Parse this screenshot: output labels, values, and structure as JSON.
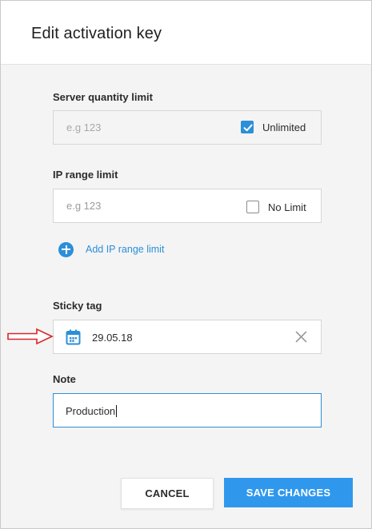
{
  "dialog": {
    "title": "Edit activation key"
  },
  "server_quantity": {
    "label": "Server quantity limit",
    "placeholder": "e.g 123",
    "checkbox_label": "Unlimited",
    "checked": true
  },
  "ip_range": {
    "label": "IP range limit",
    "placeholder": "e.g 123",
    "checkbox_label": "No Limit",
    "checked": false,
    "add_label": "Add IP range limit"
  },
  "sticky_tag": {
    "label": "Sticky tag",
    "value": "29.05.18",
    "icon": "calendar-icon"
  },
  "note": {
    "label": "Note",
    "value": "Production"
  },
  "buttons": {
    "cancel": "CANCEL",
    "save": "SAVE CHANGES"
  },
  "colors": {
    "accent": "#2c8fd8",
    "save_button": "#2f98ec",
    "annotation_arrow": "#d9262b"
  }
}
